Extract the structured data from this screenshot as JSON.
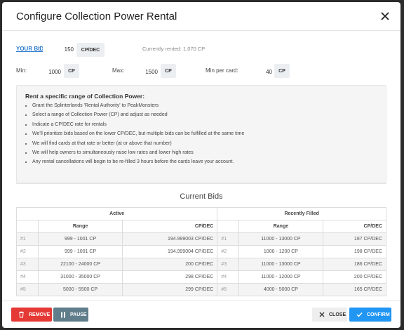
{
  "modal": {
    "title": "Configure Collection Power Rental"
  },
  "bid": {
    "label": "YOUR BID",
    "colon": ":",
    "value": "150",
    "unit": "CP/DEC",
    "currently_rented": "Currently rented: 1,070 CP"
  },
  "limits": {
    "min_label": "Min:",
    "min_value": "1000",
    "min_unit": "CP",
    "max_label": "Max:",
    "max_value": "1500",
    "max_unit": "CP",
    "per_card_label": "Min per card:",
    "per_card_value": "40",
    "per_card_unit": "CP"
  },
  "info": {
    "title": "Rent a specific range of Collection Power:",
    "items": [
      "Grant the Splinterlands 'Rental Authority' to PeakMonsters",
      "Select a range of Collection Power (CP) and adjust as needed",
      "Indicate a CP/DEC rate for rentals",
      "We'll prioritize bids based on the lower CP/DEC, but multiple bids can be fulfilled at the same time",
      "We will find cards at that rate or better (at or above that number)",
      "We will help owners to simultaneously raise low rates and lower high rates",
      "Any rental cancellations will begin to be re-filled 3 hours before the cards leave your account."
    ]
  },
  "current_bids": {
    "title": "Current Bids",
    "active_header": "Active",
    "filled_header": "Recently Filled",
    "col_range": "Range",
    "col_rate": "CP/DEC",
    "active": [
      {
        "idx": "#1",
        "range": "999 - 1001 CP",
        "rate": "194.999003 CP/DEC"
      },
      {
        "idx": "#2",
        "range": "999 - 1001 CP",
        "rate": "194.999004 CP/DEC"
      },
      {
        "idx": "#3",
        "range": "22100 - 24000 CP",
        "rate": "200 CP/DEC"
      },
      {
        "idx": "#4",
        "range": "31000 - 35000 CP",
        "rate": "298 CP/DEC"
      },
      {
        "idx": "#5",
        "range": "5000 - 5500 CP",
        "rate": "299 CP/DEC"
      }
    ],
    "filled": [
      {
        "idx": "#1",
        "range": "11000 - 13000 CP",
        "rate": "187 CP/DEC"
      },
      {
        "idx": "#2",
        "range": "1000 - 1200 CP",
        "rate": "198 CP/DEC"
      },
      {
        "idx": "#3",
        "range": "11000 - 13000 CP",
        "rate": "186 CP/DEC"
      },
      {
        "idx": "#4",
        "range": "11000 - 12000 CP",
        "rate": "200 CP/DEC"
      },
      {
        "idx": "#5",
        "range": "4000 - 5000 CP",
        "rate": "165 CP/DEC"
      }
    ]
  },
  "footer": {
    "remove": "REMOVE",
    "pause": "PAUSE",
    "close": "CLOSE",
    "confirm": "CONFIRM"
  },
  "colors": {
    "remove": "#e53935",
    "pause": "#607d8b",
    "confirm": "#2196f3",
    "link": "#2a7bd1"
  },
  "icons": {
    "close": "close-icon",
    "remove": "trash-icon",
    "pause": "pause-icon",
    "close_btn": "x-icon",
    "confirm": "check-icon"
  }
}
